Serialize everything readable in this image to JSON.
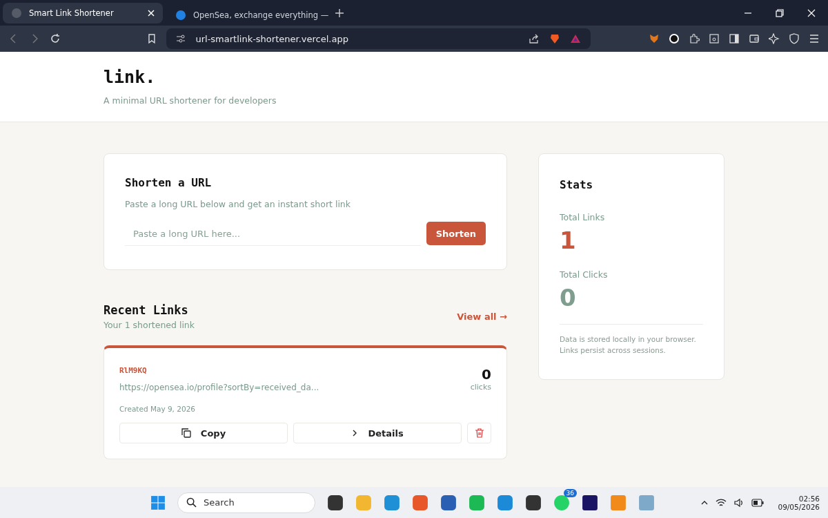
{
  "browser": {
    "tabs": [
      {
        "title": "Smart Link Shortener",
        "selected": true
      },
      {
        "title": "OpenSea, exchange everything —",
        "selected": false
      }
    ],
    "address": "url-smartlink-shortener.vercel.app"
  },
  "header": {
    "logo": "link.",
    "tagline": "A minimal URL shortener for developers"
  },
  "shorten": {
    "title": "Shorten a URL",
    "subtitle": "Paste a long URL below and get an instant short link",
    "placeholder": "Paste a long URL here...",
    "button": "Shorten"
  },
  "recent": {
    "title": "Recent Links",
    "subtitle": "Your 1 shortened link",
    "view_all": "View all →",
    "links": [
      {
        "code": "RlM9KQ",
        "url": "https://opensea.io/profile?sortBy=received_da...",
        "created": "Created May 9, 2026",
        "clicks": "0",
        "clicks_label": "clicks",
        "copy": "Copy",
        "details": "Details"
      }
    ]
  },
  "stats": {
    "title": "Stats",
    "items": [
      {
        "label": "Total Links",
        "value": "1",
        "color": "#c9553a"
      },
      {
        "label": "Total Clicks",
        "value": "0",
        "color": "#7f9e90"
      }
    ],
    "note": "Data is stored locally in your browser. Links persist across sessions."
  },
  "taskbar": {
    "search_placeholder": "Search",
    "badge": "36",
    "time": "02:56",
    "date": "09/05/2026"
  }
}
